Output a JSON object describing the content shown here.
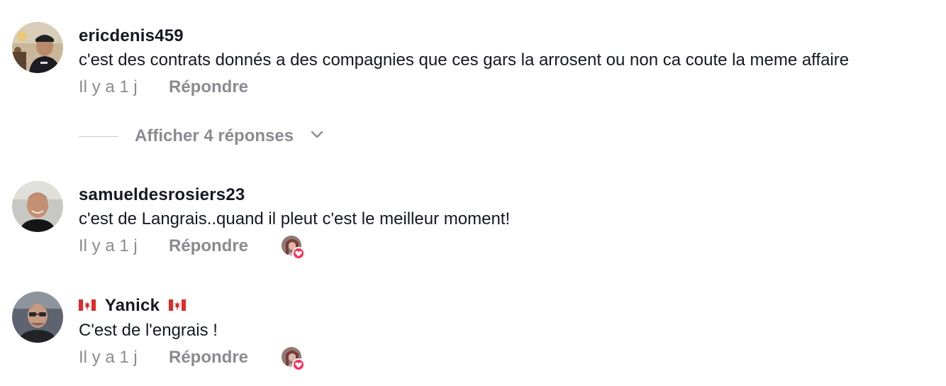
{
  "comments": [
    {
      "username": "ericdenis459",
      "text": "c'est des contrats donnés a des compagnies que ces gars la arrosent ou non ca coute la meme affaire",
      "time": "Il y a 1 j",
      "reply_label": "Répondre",
      "avatar_icon": "user-avatar",
      "creator_liked": false
    },
    {
      "username": "samueldesrosiers23",
      "text": "c'est de Langrais..quand il pleut c'est le meilleur moment!",
      "time": "Il y a 1 j",
      "reply_label": "Répondre",
      "avatar_icon": "user-avatar",
      "creator_liked": true
    },
    {
      "username": "Yanick",
      "username_flag_icon": "canada-flag-icon",
      "text": "C'est de l'engrais !",
      "time": "Il y a 1 j",
      "reply_label": "Répondre",
      "avatar_icon": "user-avatar",
      "creator_liked": true
    }
  ],
  "replies_toggle": {
    "label": "Afficher 4 réponses",
    "icon": "chevron-down-icon"
  },
  "colors": {
    "text_primary": "#161823",
    "text_secondary": "#8a8b91",
    "like_badge": "#fe2c55"
  }
}
